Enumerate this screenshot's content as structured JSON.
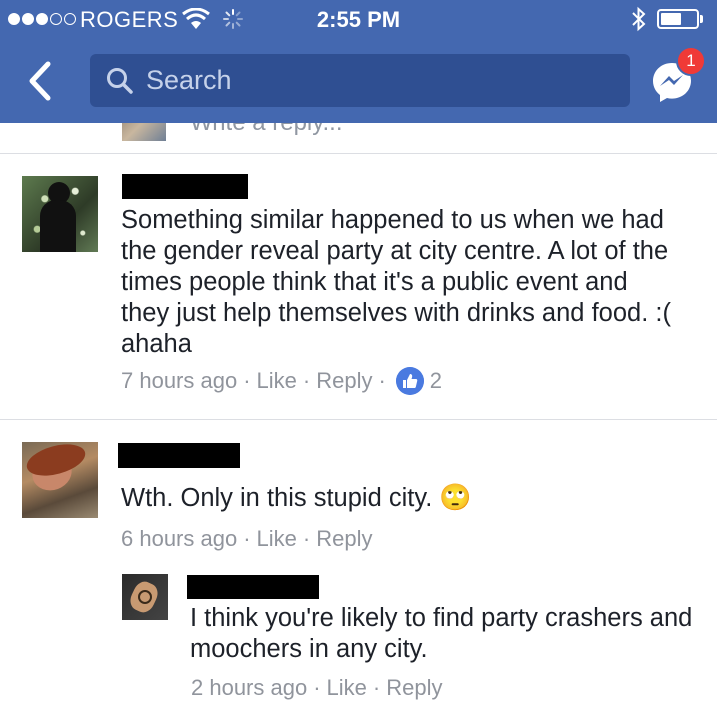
{
  "status_bar": {
    "carrier": "ROGERS",
    "time": "2:55 PM"
  },
  "nav": {
    "search_placeholder": "Search",
    "messenger_badge": "1"
  },
  "partial_reply": {
    "placeholder": "Write a reply..."
  },
  "comments": [
    {
      "text": "Something similar happened to us when we had the gender reveal party at city centre. A lot of the times people think that it's a public event and they just help themselves with drinks and food. :( ahaha",
      "time": "7 hours ago",
      "like_label": "Like",
      "reply_label": "Reply",
      "reactions_count": "2"
    },
    {
      "text": "Wth. Only in this stupid city.",
      "emoji": "🙄",
      "time": "6 hours ago",
      "like_label": "Like",
      "reply_label": "Reply"
    }
  ],
  "reply": {
    "text": "I think you're likely to find party crashers and moochers in any city.",
    "time": "2 hours ago",
    "like_label": "Like",
    "reply_label": "Reply"
  },
  "colors": {
    "nav_blue": "#4468b0",
    "search_bg": "#2f4f92",
    "badge_red": "#f03a37",
    "like_blue": "#4a7ae0",
    "meta_gray": "#90949c"
  }
}
